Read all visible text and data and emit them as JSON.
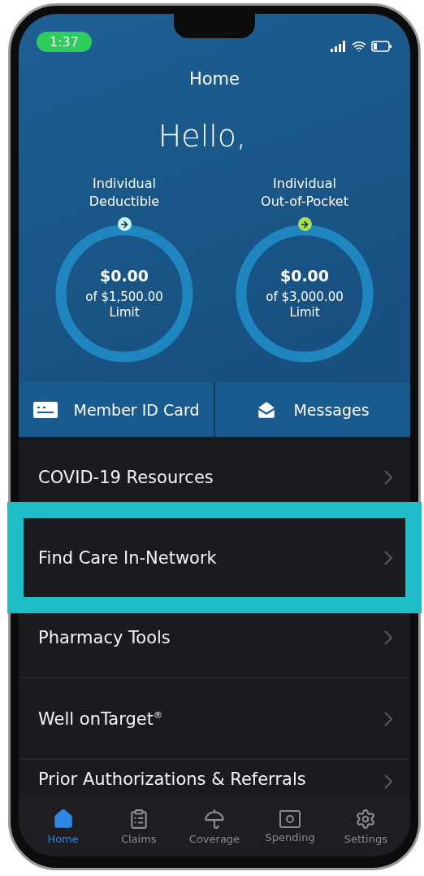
{
  "status_bar": {
    "time": "1:37"
  },
  "header": {
    "title": "Home",
    "greeting": "Hello,"
  },
  "gauges": [
    {
      "label": "Individual\nDeductible",
      "value": "$0.00",
      "limit": "of $1,500.00\nLimit",
      "color": "#c4f1f6"
    },
    {
      "label": "Individual\nOut-of-Pocket",
      "value": "$0.00",
      "limit": "of $3,000.00\nLimit",
      "color": "#a9e04c"
    }
  ],
  "actions": [
    {
      "kind": "card",
      "label": "Member ID Card"
    },
    {
      "kind": "mail",
      "label": "Messages"
    }
  ],
  "menu": [
    {
      "label": "COVID-19 Resources",
      "highlighted": false
    },
    {
      "label": "Find Care In-Network",
      "highlighted": true
    },
    {
      "label": "Pharmacy Tools",
      "highlighted": false
    },
    {
      "label": "Well onTarget$^{®}$",
      "highlighted": false
    },
    {
      "label": "Prior Authorizations & Referrals",
      "highlighted": false
    }
  ],
  "tabs": [
    {
      "kind": "home",
      "label": "Home",
      "selected": true
    },
    {
      "kind": "claims",
      "label": "Claims",
      "selected": false
    },
    {
      "kind": "coverage",
      "label": "Coverage",
      "selected": false
    },
    {
      "kind": "spending",
      "label": "Spending",
      "selected": false
    },
    {
      "kind": "settings",
      "label": "Settings",
      "selected": false
    }
  ]
}
